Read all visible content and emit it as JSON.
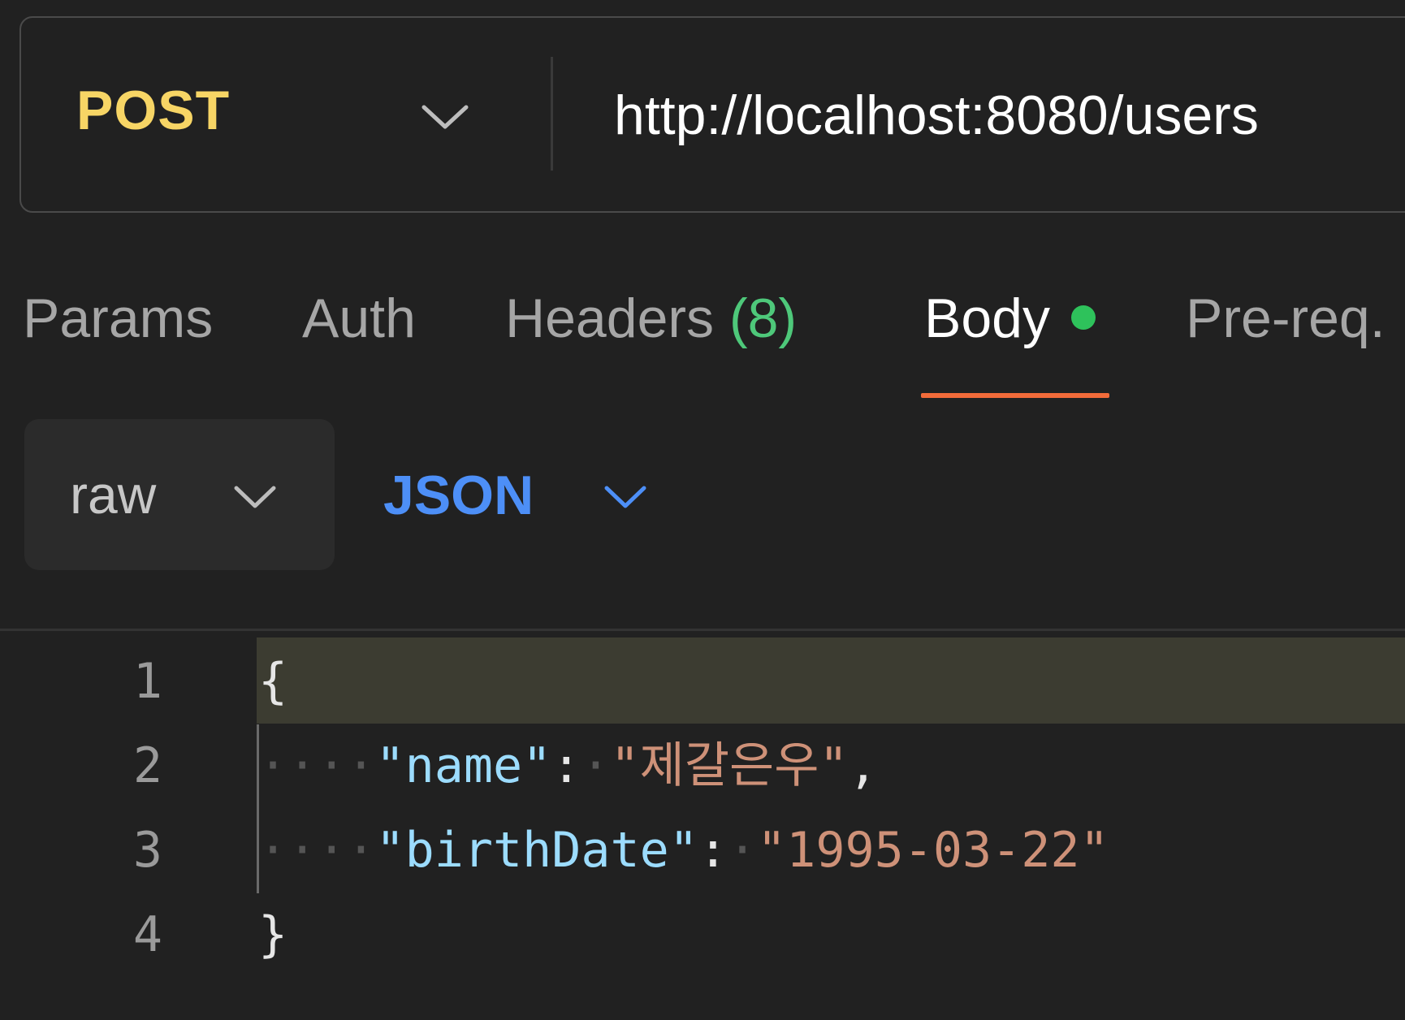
{
  "request": {
    "method": "POST",
    "method_color": "#f7d565",
    "url": "http://localhost:8080/users"
  },
  "tabs": [
    {
      "label": "Params"
    },
    {
      "label": "Auth"
    },
    {
      "label": "Headers",
      "count": "(8)"
    },
    {
      "label": "Body",
      "active": true
    },
    {
      "label": "Pre-req."
    }
  ],
  "accent_color": "#f26b3a",
  "body_dot_color": "#2ec25b",
  "body_options": {
    "mode": "raw",
    "language": "JSON",
    "language_color": "#4d8ff7"
  },
  "editor": {
    "lines": [
      {
        "number": "1",
        "text": "{"
      },
      {
        "number": "2",
        "indent": "····",
        "key": "\"name\"",
        "separator": ":",
        "space": "·",
        "value": "\"제갈은우\"",
        "trail": ","
      },
      {
        "number": "3",
        "indent": "····",
        "key": "\"birthDate\"",
        "separator": ":",
        "space": "·",
        "value": "\"1995-03-22\"",
        "trail": ""
      },
      {
        "number": "4",
        "text": "}"
      }
    ]
  },
  "icons": {
    "method_dropdown": "chevron-down-icon",
    "mode_dropdown": "chevron-down-icon",
    "language_dropdown": "chevron-down-icon"
  }
}
